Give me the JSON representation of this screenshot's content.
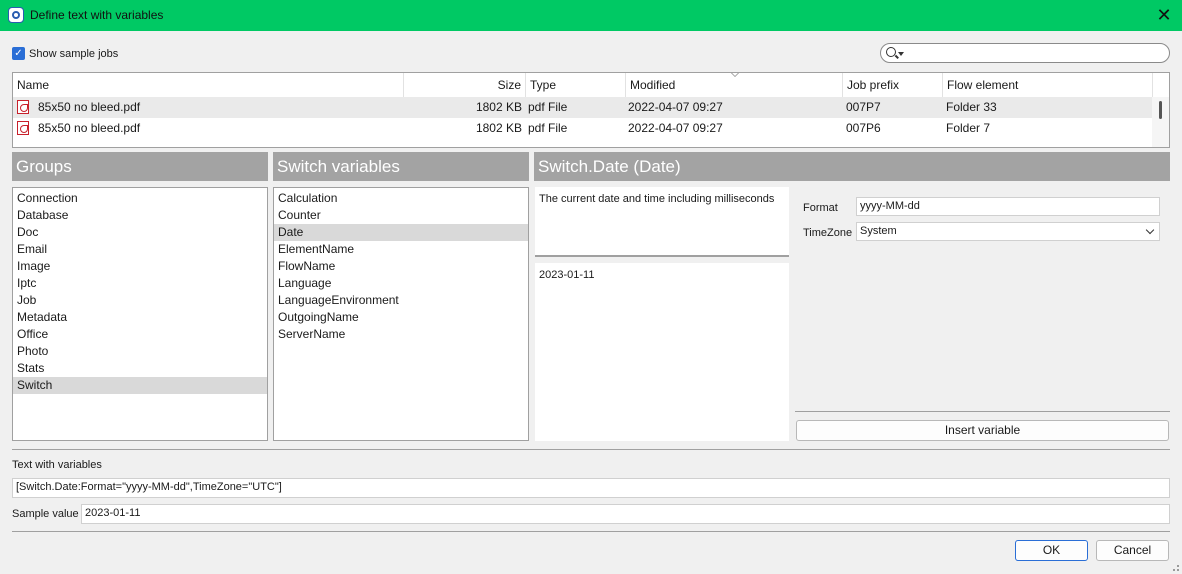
{
  "window": {
    "title": "Define text with variables",
    "close_icon": "close-icon"
  },
  "show_samples": {
    "label": "Show sample jobs",
    "checked": true
  },
  "search": {
    "placeholder": ""
  },
  "jobs_table": {
    "columns": [
      "Name",
      "Size",
      "Type",
      "Modified",
      "Job prefix",
      "Flow element"
    ],
    "rows": [
      {
        "name": "85x50 no bleed.pdf",
        "size": "1802 KB",
        "type": "pdf File",
        "modified": "2022-04-07 09:27",
        "prefix": "007P7",
        "flow": "Folder 33"
      },
      {
        "name": "85x50 no bleed.pdf",
        "size": "1802 KB",
        "type": "pdf File",
        "modified": "2022-04-07 09:27",
        "prefix": "007P6",
        "flow": "Folder 7"
      }
    ]
  },
  "groups": {
    "header": "Groups",
    "items": [
      "Connection",
      "Database",
      "Doc",
      "Email",
      "Image",
      "Iptc",
      "Job",
      "Metadata",
      "Office",
      "Photo",
      "Stats",
      "Switch"
    ],
    "selected": "Switch"
  },
  "variables": {
    "header": "Switch variables",
    "items": [
      "Calculation",
      "Counter",
      "Date",
      "ElementName",
      "FlowName",
      "Language",
      "LanguageEnvironment",
      "OutgoingName",
      "ServerName"
    ],
    "selected": "Date"
  },
  "detail": {
    "header": "Switch.Date (Date)",
    "description": "The current date and time including milliseconds",
    "sample": "2023-01-11",
    "format_label": "Format",
    "format_value": "yyyy-MM-dd",
    "timezone_label": "TimeZone",
    "timezone_value": "System",
    "insert_label": "Insert variable"
  },
  "text_with_variables": {
    "label": "Text with variables",
    "value": "[Switch.Date:Format=\"yyyy-MM-dd\",TimeZone=\"UTC\"]"
  },
  "sample_value": {
    "label": "Sample value",
    "value": "2023-01-11"
  },
  "buttons": {
    "ok": "OK",
    "cancel": "Cancel"
  },
  "colors": {
    "titlebar": "#00c964",
    "panel_header": "#a3a3a3",
    "selection": "#d9d9d9",
    "accent": "#2a6ed6"
  }
}
